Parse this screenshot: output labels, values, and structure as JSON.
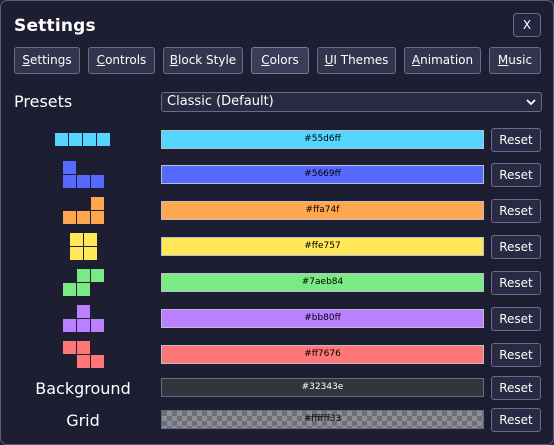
{
  "window": {
    "title": "Settings",
    "close_label": "X"
  },
  "tabs": [
    {
      "label": "Settings",
      "underline": "S",
      "rest": "ettings",
      "active": false
    },
    {
      "label": "Controls",
      "underline": "C",
      "rest": "ontrols",
      "active": false
    },
    {
      "label": "Block Style",
      "underline": "B",
      "rest": "lock Style",
      "active": false
    },
    {
      "label": "Colors",
      "underline": "C",
      "rest": "olors",
      "active": true
    },
    {
      "label": "UI Themes",
      "underline": "U",
      "rest": "I Themes",
      "active": false
    },
    {
      "label": "Animation",
      "underline": "A",
      "rest": "nimation",
      "active": false
    },
    {
      "label": "Music",
      "underline": "M",
      "rest": "usic",
      "active": false
    }
  ],
  "presets": {
    "label": "Presets",
    "selected": "Classic (Default)"
  },
  "colors": [
    {
      "piece": "I-piece-icon",
      "hex": "#55d6ff",
      "color": "#55d6ff",
      "reset_label": "Reset"
    },
    {
      "piece": "J-piece-icon",
      "hex": "#5669ff",
      "color": "#5669ff",
      "reset_label": "Reset"
    },
    {
      "piece": "L-piece-icon",
      "hex": "#ffa74f",
      "color": "#ffa74f",
      "reset_label": "Reset"
    },
    {
      "piece": "O-piece-icon",
      "hex": "#ffe757",
      "color": "#ffe757",
      "reset_label": "Reset"
    },
    {
      "piece": "S-piece-icon",
      "hex": "#7aeb84",
      "color": "#7aeb84",
      "reset_label": "Reset"
    },
    {
      "piece": "T-piece-icon",
      "hex": "#bb80ff",
      "color": "#bb80ff",
      "reset_label": "Reset"
    },
    {
      "piece": "Z-piece-icon",
      "hex": "#ff7676",
      "color": "#ff7676",
      "reset_label": "Reset"
    }
  ],
  "background": {
    "label": "Background",
    "hex": "#32343e",
    "color": "#32343e",
    "reset_label": "Reset"
  },
  "grid": {
    "label": "Grid",
    "hex": "#ffffff33",
    "reset_label": "Reset"
  }
}
